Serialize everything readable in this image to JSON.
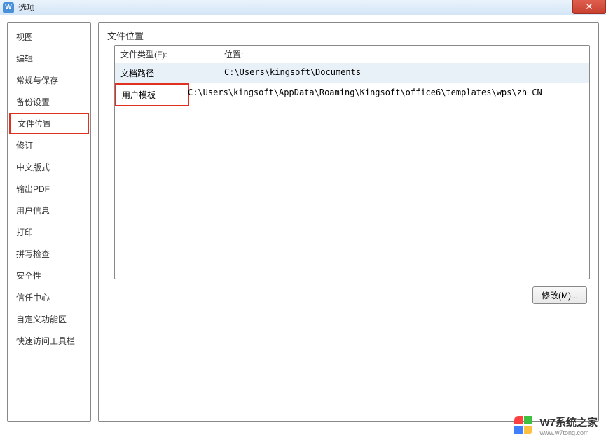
{
  "titleBar": {
    "title": "选项",
    "iconLetter": "W"
  },
  "sidebar": {
    "items": [
      {
        "label": "视图",
        "selected": false
      },
      {
        "label": "编辑",
        "selected": false
      },
      {
        "label": "常规与保存",
        "selected": false
      },
      {
        "label": "备份设置",
        "selected": false
      },
      {
        "label": "文件位置",
        "selected": true
      },
      {
        "label": "修订",
        "selected": false
      },
      {
        "label": "中文版式",
        "selected": false
      },
      {
        "label": "输出PDF",
        "selected": false
      },
      {
        "label": "用户信息",
        "selected": false
      },
      {
        "label": "打印",
        "selected": false
      },
      {
        "label": "拼写检查",
        "selected": false
      },
      {
        "label": "安全性",
        "selected": false
      },
      {
        "label": "信任中心",
        "selected": false
      },
      {
        "label": "自定义功能区",
        "selected": false
      },
      {
        "label": "快速访问工具栏",
        "selected": false
      }
    ]
  },
  "content": {
    "sectionTitle": "文件位置",
    "tableHeader": {
      "col1": "文件类型(F):",
      "col2": "位置:"
    },
    "rows": [
      {
        "type": "文档路径",
        "location": "C:\\Users\\kingsoft\\Documents",
        "highlighted": false,
        "bgHighlight": true
      },
      {
        "type": "用户模板",
        "location": "C:\\Users\\kingsoft\\AppData\\Roaming\\Kingsoft\\office6\\templates\\wps\\zh_CN",
        "highlighted": true,
        "bgHighlight": false
      }
    ],
    "modifyButton": "修改(M)..."
  },
  "watermark": {
    "title": "W7系统之家",
    "subtitle": "www.w7tong.com"
  }
}
